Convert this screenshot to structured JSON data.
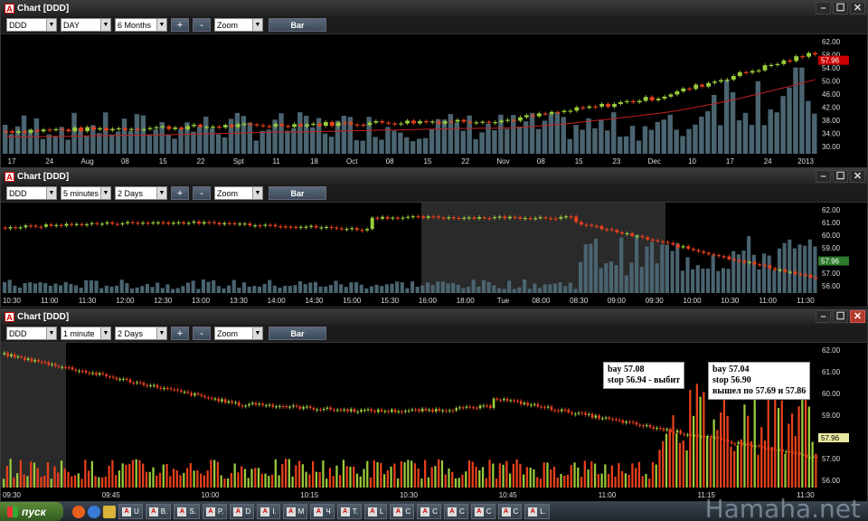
{
  "windows": [
    {
      "title": "Chart [DDD]",
      "symbol": "DDD",
      "interval": "DAY",
      "range": "6 Months",
      "zoom": "Zoom",
      "style": "Bar",
      "last_price": "57.96",
      "y_ticks": [
        "62.00",
        "58.00",
        "54.00",
        "50.00",
        "46.00",
        "42.00",
        "38.00",
        "34.00",
        "30.00"
      ],
      "x_ticks": [
        "17",
        "24",
        "Aug",
        "08",
        "15",
        "22",
        "Spt",
        "11",
        "18",
        "Oct",
        "08",
        "15",
        "22",
        "Nov",
        "08",
        "15",
        "23",
        "Dec",
        "10",
        "17",
        "24",
        "2013"
      ]
    },
    {
      "title": "Chart [DDD]",
      "symbol": "DDD",
      "interval": "5 minutes",
      "range": "2 Days",
      "zoom": "Zoom",
      "style": "Bar",
      "last_price": "57.96",
      "y_ticks": [
        "62.00",
        "61.00",
        "60.00",
        "59.00",
        "58.00",
        "57.00",
        "56.00"
      ],
      "x_ticks": [
        "10:30",
        "11:00",
        "11:30",
        "12:00",
        "12:30",
        "13:00",
        "13:30",
        "14:00",
        "14:30",
        "15:00",
        "15:30",
        "16:00",
        "18:00",
        "Tue",
        "08:00",
        "08:30",
        "09:00",
        "09:30",
        "10:00",
        "10:30",
        "11:00",
        "11:30"
      ]
    },
    {
      "title": "Chart [DDD]",
      "symbol": "DDD",
      "interval": "1 minute",
      "range": "2 Days",
      "zoom": "Zoom",
      "style": "Bar",
      "last_price": "57.96",
      "y_ticks": [
        "62.00",
        "61.00",
        "60.00",
        "59.00",
        "58.00",
        "57.00",
        "56.00"
      ],
      "x_ticks": [
        "09:30",
        "09:45",
        "10:00",
        "10:15",
        "10:30",
        "10:45",
        "11:00",
        "11:15",
        "11:30"
      ],
      "annotations": [
        {
          "lines": "bay 57.08\nstop 56.94 - выбит"
        },
        {
          "lines": "bay 57.04\nstop 56.90\nвышел по 57.69 и 57.86"
        }
      ]
    }
  ],
  "taskbar": {
    "start_label": "пуск",
    "tasks": [
      "U",
      "B.",
      "S.",
      "P.",
      "D",
      "I.",
      "M",
      "Ч",
      "T.",
      "L",
      "C",
      "C",
      "C",
      "C",
      "C",
      "L."
    ]
  },
  "watermark": "Hamaha.net",
  "colors": {
    "up": "#9bcc3c",
    "down": "#e8401c",
    "volume": "#4a6470",
    "ma": "#c42020",
    "background": "#000000"
  }
}
